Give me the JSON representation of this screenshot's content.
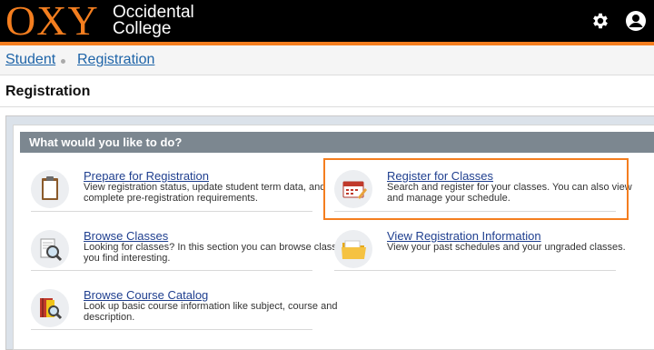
{
  "header": {
    "logo_mark": "OXY",
    "logo_line1": "Occidental",
    "logo_line2": "College",
    "brand_color": "#f47e1f",
    "icons": [
      "gear-icon",
      "user-icon"
    ]
  },
  "breadcrumb": {
    "items": [
      "Student",
      "Registration"
    ]
  },
  "page": {
    "title": "Registration"
  },
  "panel": {
    "heading": "What would you like to do?",
    "options": [
      {
        "label": "Prepare for Registration",
        "desc_line1": "View registration status, update student term data, and",
        "desc_line2": "complete pre-registration requirements.",
        "icon": "clipboard-icon"
      },
      {
        "label": "Register for Classes",
        "desc_line1": "Search and register for your classes. You can also view",
        "desc_line2": "and manage your schedule.",
        "icon": "calendar-icon"
      },
      {
        "label": "Browse Classes",
        "desc_line1": "Looking for classes? In this section you can browse classes",
        "desc_line2": "you find interesting.",
        "icon": "magnifier-icon"
      },
      {
        "label": "View Registration Information",
        "desc_line1": "View your past schedules and your ungraded classes.",
        "desc_line2": "",
        "icon": "folder-icon"
      },
      {
        "label": "Browse Course Catalog",
        "desc_line1": "Look up basic course information like subject, course and",
        "desc_line2": "description.",
        "icon": "catalog-icon"
      }
    ]
  }
}
